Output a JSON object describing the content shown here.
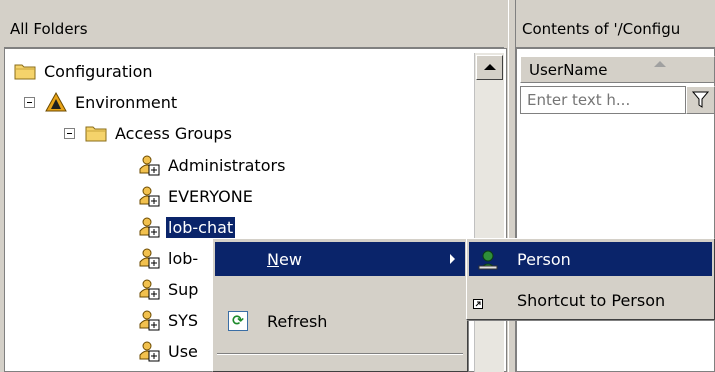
{
  "left_pane": {
    "header": "All Folders",
    "tree": [
      {
        "label": "Configuration",
        "icon": "folder-icon"
      },
      {
        "label": "Environment",
        "icon": "environment-icon"
      },
      {
        "label": "Access Groups",
        "icon": "folder-icon"
      },
      {
        "label": "Administrators",
        "icon": "access-group-icon"
      },
      {
        "label": "EVERYONE",
        "icon": "access-group-icon"
      },
      {
        "label": "lob-chat",
        "icon": "access-group-icon",
        "selected": true
      },
      {
        "label": "lob-",
        "icon": "access-group-icon"
      },
      {
        "label": "Sup",
        "icon": "access-group-icon"
      },
      {
        "label": "SYS",
        "icon": "access-group-icon"
      },
      {
        "label": "Use",
        "icon": "access-group-icon"
      }
    ]
  },
  "right_pane": {
    "header": "Contents of '/Configu",
    "column": "UserName",
    "filter_placeholder": "Enter text h..."
  },
  "context_menu": {
    "items": [
      {
        "label": "New",
        "mnemonic": "N",
        "rest": "ew"
      },
      {
        "label": "Refresh"
      }
    ]
  },
  "submenu": {
    "items": [
      {
        "label": "Person"
      },
      {
        "label": "Shortcut to Person"
      }
    ]
  },
  "colors": {
    "selection": "#0a246a",
    "chrome": "#d4d0c8",
    "folder": "#f5d36b",
    "person_green": "#2f8f3a"
  }
}
